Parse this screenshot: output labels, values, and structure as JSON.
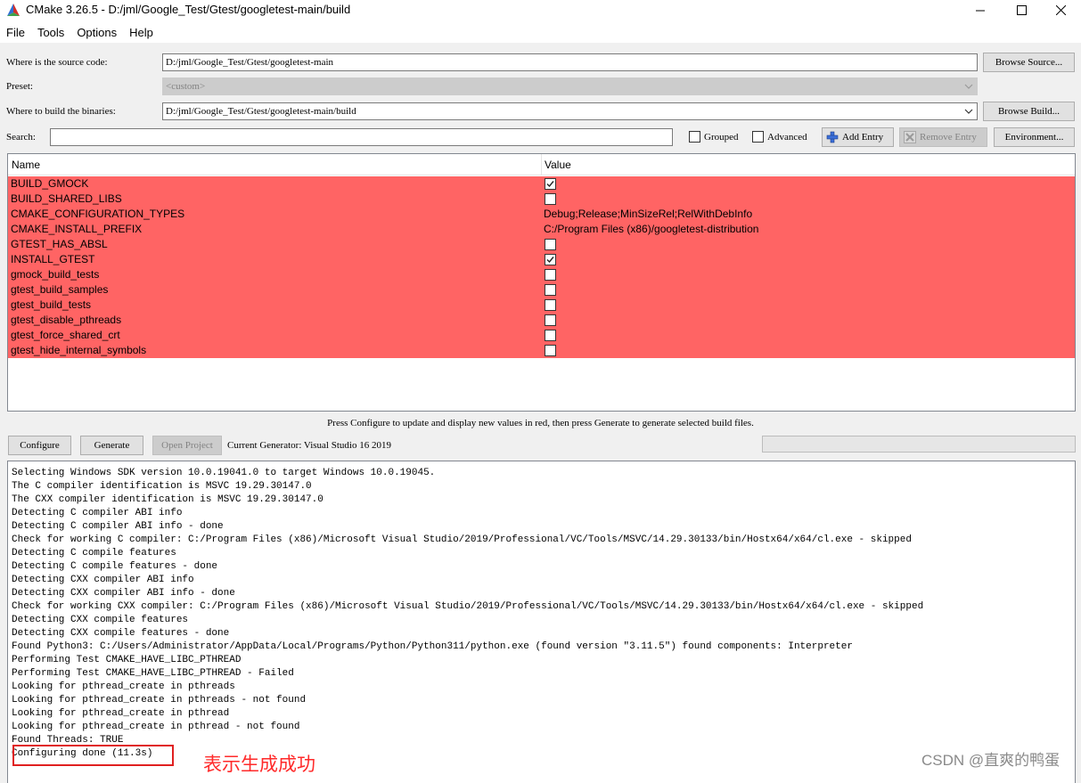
{
  "window": {
    "title": "CMake 3.26.5 - D:/jml/Google_Test/Gtest/googletest-main/build",
    "icon": "cmake-triangle-icon"
  },
  "menu": [
    "File",
    "Tools",
    "Options",
    "Help"
  ],
  "source": {
    "label": "Where is the source code:",
    "value": "D:/jml/Google_Test/Gtest/googletest-main",
    "browse_label": "Browse Source..."
  },
  "preset": {
    "label": "Preset:",
    "value": "<custom>"
  },
  "build": {
    "label": "Where to build the binaries:",
    "value": "D:/jml/Google_Test/Gtest/googletest-main/build",
    "browse_label": "Browse Build..."
  },
  "search": {
    "label": "Search:",
    "value": "",
    "grouped_label": "Grouped",
    "grouped_checked": false,
    "advanced_label": "Advanced",
    "advanced_checked": false,
    "add_entry_label": "Add Entry",
    "remove_entry_label": "Remove Entry",
    "environment_label": "Environment..."
  },
  "table": {
    "headers": {
      "name": "Name",
      "value": "Value"
    },
    "row_color": "#ff6464",
    "rows": [
      {
        "name": "BUILD_GMOCK",
        "type": "bool",
        "checked": true,
        "value": ""
      },
      {
        "name": "BUILD_SHARED_LIBS",
        "type": "bool",
        "checked": false,
        "value": ""
      },
      {
        "name": "CMAKE_CONFIGURATION_TYPES",
        "type": "string",
        "checked": false,
        "value": "Debug;Release;MinSizeRel;RelWithDebInfo"
      },
      {
        "name": "CMAKE_INSTALL_PREFIX",
        "type": "string",
        "checked": false,
        "value": "C:/Program Files (x86)/googletest-distribution"
      },
      {
        "name": "GTEST_HAS_ABSL",
        "type": "bool",
        "checked": false,
        "value": ""
      },
      {
        "name": "INSTALL_GTEST",
        "type": "bool",
        "checked": true,
        "value": ""
      },
      {
        "name": "gmock_build_tests",
        "type": "bool",
        "checked": false,
        "value": ""
      },
      {
        "name": "gtest_build_samples",
        "type": "bool",
        "checked": false,
        "value": ""
      },
      {
        "name": "gtest_build_tests",
        "type": "bool",
        "checked": false,
        "value": ""
      },
      {
        "name": "gtest_disable_pthreads",
        "type": "bool",
        "checked": false,
        "value": ""
      },
      {
        "name": "gtest_force_shared_crt",
        "type": "bool",
        "checked": false,
        "value": ""
      },
      {
        "name": "gtest_hide_internal_symbols",
        "type": "bool",
        "checked": false,
        "value": ""
      }
    ]
  },
  "hint": "Press Configure to update and display new values in red, then press Generate to generate selected build files.",
  "actions": {
    "configure_label": "Configure",
    "generate_label": "Generate",
    "open_project_label": "Open Project",
    "generator_text": "Current Generator: Visual Studio 16 2019"
  },
  "log": [
    "Selecting Windows SDK version 10.0.19041.0 to target Windows 10.0.19045.",
    "The C compiler identification is MSVC 19.29.30147.0",
    "The CXX compiler identification is MSVC 19.29.30147.0",
    "Detecting C compiler ABI info",
    "Detecting C compiler ABI info - done",
    "Check for working C compiler: C:/Program Files (x86)/Microsoft Visual Studio/2019/Professional/VC/Tools/MSVC/14.29.30133/bin/Hostx64/x64/cl.exe - skipped",
    "Detecting C compile features",
    "Detecting C compile features - done",
    "Detecting CXX compiler ABI info",
    "Detecting CXX compiler ABI info - done",
    "Check for working CXX compiler: C:/Program Files (x86)/Microsoft Visual Studio/2019/Professional/VC/Tools/MSVC/14.29.30133/bin/Hostx64/x64/cl.exe - skipped",
    "Detecting CXX compile features",
    "Detecting CXX compile features - done",
    "Found Python3: C:/Users/Administrator/AppData/Local/Programs/Python/Python311/python.exe (found version \"3.11.5\") found components: Interpreter",
    "Performing Test CMAKE_HAVE_LIBC_PTHREAD",
    "Performing Test CMAKE_HAVE_LIBC_PTHREAD - Failed",
    "Looking for pthread_create in pthreads",
    "Looking for pthread_create in pthreads - not found",
    "Looking for pthread_create in pthread",
    "Looking for pthread_create in pthread - not found",
    "Found Threads: TRUE",
    "Configuring done (11.3s)"
  ],
  "annotation": {
    "text": "表示生成成功",
    "color": "#ff2a2a"
  },
  "watermark": "CSDN @直爽的鸭蛋"
}
